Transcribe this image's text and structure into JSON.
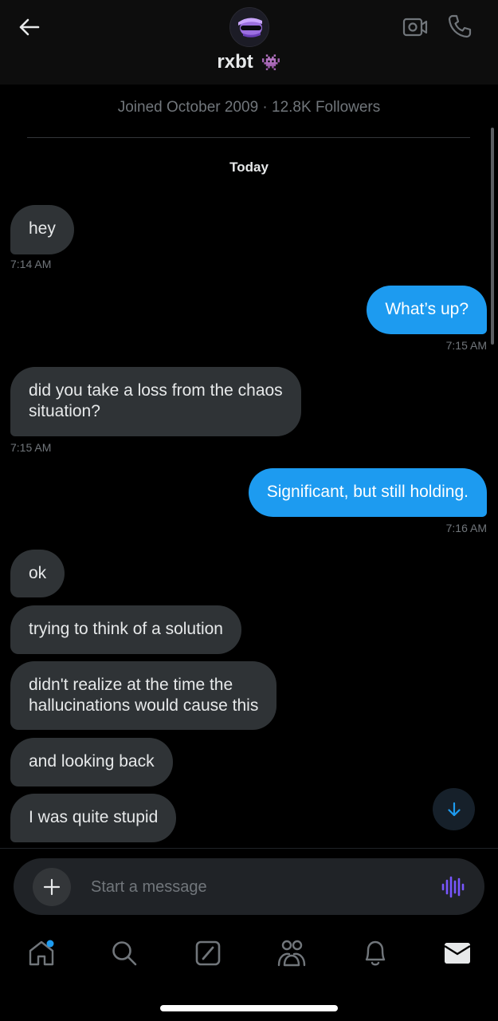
{
  "header": {
    "title": "rxbt",
    "title_emoji": "👾",
    "back_icon": "arrow-left-icon",
    "video_icon": "video-camera-icon",
    "call_icon": "phone-icon"
  },
  "profile": {
    "info": "Joined October 2009 · 12.8K Followers"
  },
  "thread": {
    "day_label": "Today",
    "messages": [
      {
        "direction": "in",
        "text": "hey",
        "time": "7:14 AM"
      },
      {
        "direction": "out",
        "text": "What’s up?",
        "time": "7:15 AM"
      },
      {
        "direction": "in",
        "text": "did you take a loss from the chaos\nsituation?",
        "time": "7:15 AM"
      },
      {
        "direction": "out",
        "text": "Significant, but still holding.",
        "time": "7:16 AM"
      },
      {
        "direction": "in",
        "text": "ok"
      },
      {
        "direction": "in",
        "text": "trying to think of a solution"
      },
      {
        "direction": "in",
        "text": "didn't realize at the time the\nhallucinations would cause this"
      },
      {
        "direction": "in",
        "text": "and looking back"
      },
      {
        "direction": "in",
        "text": "I was quite stupid"
      }
    ]
  },
  "composer": {
    "placeholder": "Start a message",
    "add_icon": "plus-icon",
    "voice_icon": "voice-wave-icon"
  },
  "tabbar": {
    "items": [
      "home-icon",
      "search-icon",
      "grok-icon",
      "communities-icon",
      "notifications-icon",
      "messages-icon"
    ],
    "active": "messages-icon",
    "accent": "#1d9bf0"
  },
  "colors": {
    "incoming_bubble": "#2f3336",
    "outgoing_bubble": "#1d9bf0",
    "background": "#000000"
  }
}
